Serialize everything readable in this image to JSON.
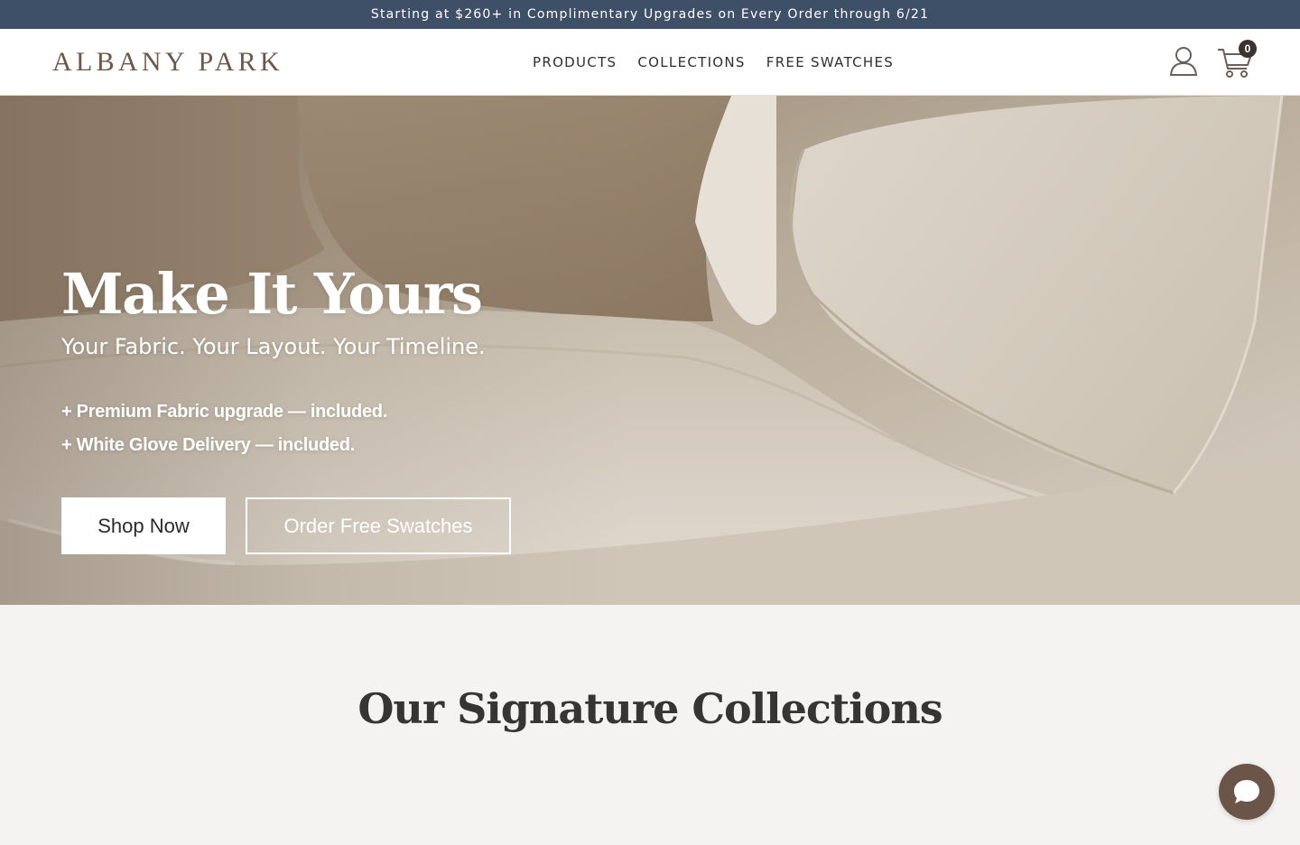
{
  "promo": {
    "text": "Starting at $260+ in Complimentary Upgrades on Every Order through 6/21"
  },
  "header": {
    "logo": "ALBANY PARK",
    "nav": [
      {
        "label": "PRODUCTS"
      },
      {
        "label": "COLLECTIONS"
      },
      {
        "label": "FREE SWATCHES"
      }
    ],
    "account_icon": "user-icon",
    "cart_icon": "cart-icon",
    "cart_count": "0"
  },
  "hero": {
    "title": "Make It Yours",
    "subtitle": "Your Fabric. Your Layout. Your Timeline.",
    "benefits": [
      "+ Premium Fabric upgrade — included.",
      "+ White Glove Delivery — included."
    ],
    "primary_button": "Shop Now",
    "secondary_button": "Order Free Swatches"
  },
  "collections": {
    "title": "Our Signature Collections"
  },
  "chat": {
    "icon": "chat-bubble-icon"
  },
  "colors": {
    "promo_bg": "#3e5068",
    "logo": "#6d5746",
    "cart_badge": "#3b3330",
    "chat_button": "#6b5448",
    "page_bg": "#f4f3f1"
  }
}
